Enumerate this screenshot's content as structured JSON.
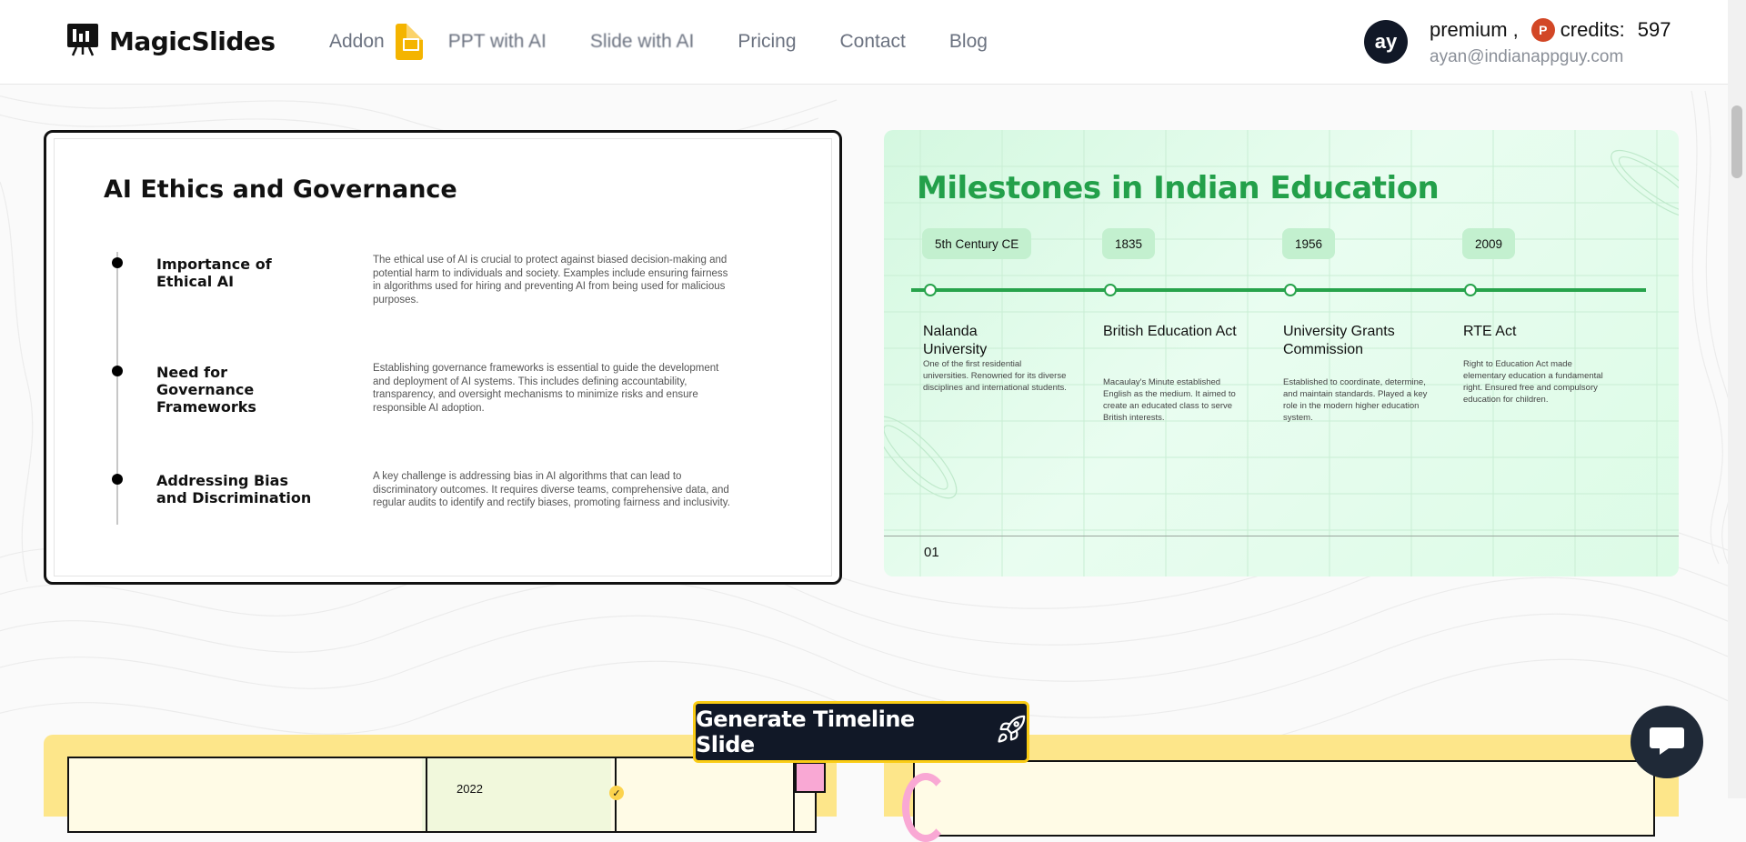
{
  "header": {
    "logo_text": "MagicSlides",
    "nav": {
      "addon": "Addon",
      "ppt_with_ai": "PPT with AI",
      "slide_with_ai": "Slide with AI",
      "pricing": "Pricing",
      "contact": "Contact",
      "blog": "Blog"
    },
    "account": {
      "avatar_initials": "ay",
      "plan": "premium ,",
      "credits_label": "credits:",
      "credits_value": "597",
      "email": "ayan@indianappguy.com"
    }
  },
  "card_ethics": {
    "title": "AI Ethics and Governance",
    "items": [
      {
        "heading": "Importance of Ethical AI",
        "description": "The ethical use of AI is crucial to protect against biased decision-making and potential harm to individuals and society. Examples include ensuring fairness in algorithms used for hiring and preventing AI from being used for malicious purposes."
      },
      {
        "heading": "Need for Governance Frameworks",
        "description": "Establishing governance frameworks is essential to guide the development and deployment of AI systems. This includes defining accountability, transparency, and oversight mechanisms to minimize risks and ensure responsible AI adoption."
      },
      {
        "heading": "Addressing Bias and Discrimination",
        "description": "A key challenge is addressing bias in AI algorithms that can lead to discriminatory outcomes. It requires diverse teams, comprehensive data, and regular audits to identify and rectify biases, promoting fairness and inclusivity."
      }
    ]
  },
  "card_milestones": {
    "title": "Milestones in Indian Education",
    "accent_color": "#23a04a",
    "milestones": [
      {
        "year": "5th Century CE",
        "heading": "Nalanda University",
        "description": "One of the first residential universities. Renowned for its diverse disciplines and international students."
      },
      {
        "year": "1835",
        "heading": "British Education Act",
        "description": "Macaulay's Minute established English as the medium. It aimed to create an educated class to serve British interests."
      },
      {
        "year": "1956",
        "heading": "University Grants Commission",
        "description": "Established to coordinate, determine, and maintain standards. Played a key role in the modern higher education system."
      },
      {
        "year": "2009",
        "heading": "RTE Act",
        "description": "Right to Education Act made elementary education a fundamental right. Ensured free and compulsory education for children."
      }
    ],
    "page_number": "01"
  },
  "card_bottom_left": {
    "year": "2022"
  },
  "generate_button": {
    "label": "Generate Timeline Slide"
  },
  "icons": {
    "logo": "presentation-board-icon",
    "addon": "google-slides-icon",
    "credits": "powerpoint-icon",
    "generate": "rocket-icon",
    "chat": "chat-bubble-icon"
  }
}
